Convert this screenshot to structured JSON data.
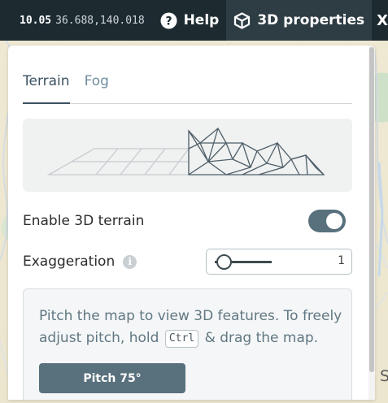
{
  "topbar": {
    "zoom": "10.05",
    "coordinates": "36.688,140.018",
    "help_label": "Help",
    "properties_label": "3D properties",
    "close_label": "X"
  },
  "map": {
    "label": "S"
  },
  "panel": {
    "tabs": [
      {
        "label": "Terrain",
        "active": true
      },
      {
        "label": "Fog",
        "active": false
      }
    ],
    "enable_terrain_label": "Enable 3D terrain",
    "enable_terrain_on": true,
    "exaggeration_label": "Exaggeration",
    "exaggeration_value": "1",
    "info_text_before": "Pitch the map to view 3D features. To freely adjust pitch, hold",
    "info_key": "Ctrl",
    "info_text_after": "& drag the map.",
    "pitch_button_label": "Pitch 75°"
  },
  "colors": {
    "topbar_bg": "#1d2b31",
    "toggle_on": "#59707d",
    "button": "#59707d"
  }
}
